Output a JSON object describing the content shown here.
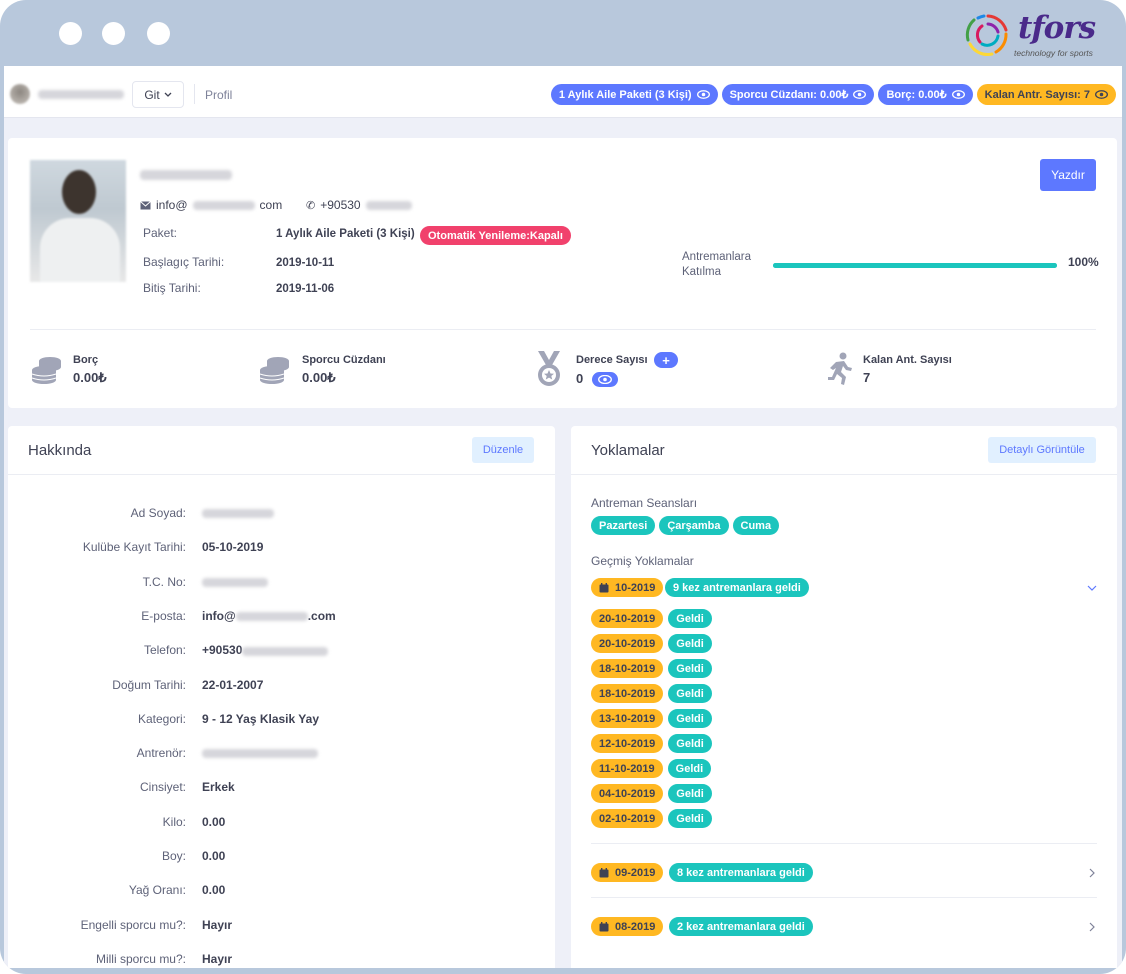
{
  "logo": {
    "word": "tfors",
    "tagline": "technology for sports"
  },
  "topbar": {
    "user_name": "",
    "git_label": "Git",
    "breadcrumb": "Profil",
    "pills": [
      {
        "label": "1 Aylık Aile Paketi (3 Kişi)",
        "color": "#5d78ff"
      },
      {
        "label": "Sporcu Cüzdanı: 0.00₺",
        "color": "#5d78ff"
      },
      {
        "label": "Borç: 0.00₺",
        "color": "#5d78ff"
      },
      {
        "label": "Kalan Antr. Sayısı: 7",
        "color": "#ffb822"
      }
    ]
  },
  "profile": {
    "email_prefix": "info@",
    "email_suffix": "com",
    "phone_prefix": "+90530",
    "package_label": "Paket:",
    "package_value": "1 Aylık Aile Paketi (3 Kişi)",
    "auto_renew": "Otomatik Yenileme:Kapalı",
    "start_label": "Başlagıç Tarihi:",
    "start_value": "2019-10-11",
    "end_label": "Bitiş Tarihi:",
    "end_value": "2019-11-06",
    "print_button": "Yazdır",
    "attendance_label_1": "Antremanlara",
    "attendance_label_2": "Katılma",
    "attendance_percent": "100%",
    "attendance_fraction": 1.0
  },
  "stats": [
    {
      "label": "Borç",
      "value": "0.00₺",
      "icon": "coins-icon"
    },
    {
      "label": "Sporcu Cüzdanı",
      "value": "0.00₺",
      "icon": "coins-icon"
    },
    {
      "label": "Derece Sayısı",
      "value": "0",
      "icon": "medal-icon"
    },
    {
      "label": "Kalan Ant. Sayısı",
      "value": "7",
      "icon": "runner-icon"
    }
  ],
  "about": {
    "title": "Hakkında",
    "edit_button": "Düzenle",
    "rows": [
      {
        "label": "Ad Soyad:",
        "value": ""
      },
      {
        "label": "Kulübe Kayıt Tarihi:",
        "value": "05-10-2019"
      },
      {
        "label": "T.C. No:",
        "value": ""
      },
      {
        "label": "E-posta:",
        "value": "info@",
        "value_suffix": ".com"
      },
      {
        "label": "Telefon:",
        "value": "+90530"
      },
      {
        "label": "Doğum Tarihi:",
        "value": "22-01-2007"
      },
      {
        "label": "Kategori:",
        "value": "9 - 12 Yaş Klasik Yay"
      },
      {
        "label": "Antrenör:",
        "value": ""
      },
      {
        "label": "Cinsiyet:",
        "value": "Erkek"
      },
      {
        "label": "Kilo:",
        "value": "0.00"
      },
      {
        "label": "Boy:",
        "value": "0.00"
      },
      {
        "label": "Yağ Oranı:",
        "value": "0.00"
      },
      {
        "label": "Engelli sporcu mu?:",
        "value": "Hayır"
      },
      {
        "label": "Milli sporcu mu?:",
        "value": "Hayır"
      }
    ]
  },
  "attendance": {
    "title": "Yoklamalar",
    "detail_button": "Detaylı Görüntüle",
    "sessions_title": "Antreman Seansları",
    "sessions": [
      "Pazartesi",
      "Çarşamba",
      "Cuma"
    ],
    "history_title": "Geçmiş Yoklamalar",
    "months": [
      {
        "month": "10-2019",
        "summary": "9 kez antremanlara geldi",
        "expanded": true,
        "entries": [
          {
            "date": "20-10-2019",
            "status": "Geldi"
          },
          {
            "date": "20-10-2019",
            "status": "Geldi"
          },
          {
            "date": "18-10-2019",
            "status": "Geldi"
          },
          {
            "date": "18-10-2019",
            "status": "Geldi"
          },
          {
            "date": "13-10-2019",
            "status": "Geldi"
          },
          {
            "date": "12-10-2019",
            "status": "Geldi"
          },
          {
            "date": "11-10-2019",
            "status": "Geldi"
          },
          {
            "date": "04-10-2019",
            "status": "Geldi"
          },
          {
            "date": "02-10-2019",
            "status": "Geldi"
          }
        ]
      },
      {
        "month": "09-2019",
        "summary": "8 kez antremanlara geldi",
        "expanded": false
      },
      {
        "month": "08-2019",
        "summary": "2 kez antremanlara geldi",
        "expanded": false
      }
    ]
  }
}
